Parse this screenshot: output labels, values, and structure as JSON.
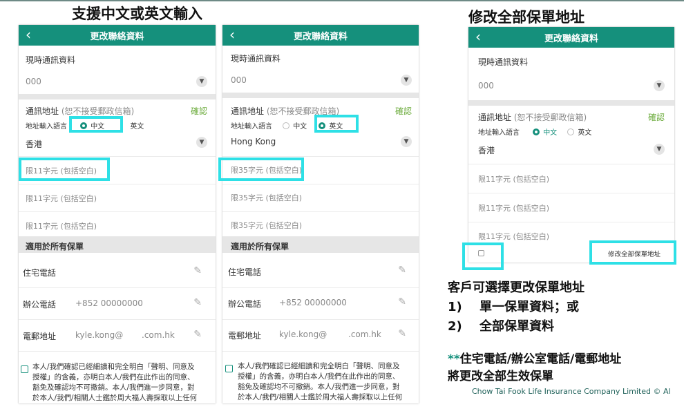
{
  "headings": {
    "left": "支援中文或英文輸入",
    "right": "修改全部保單地址"
  },
  "phones": {
    "header_title": "更改聯絡資料",
    "current_info_label": "現時通訊資料",
    "current_value_left": "000",
    "current_value_mid": "000",
    "current_value_right": "000",
    "address_label": "通訊地址",
    "address_note": "(恕不接受郵政信箱)",
    "confirm": "確認",
    "lang_label": "地址輸入語言",
    "lang_zh": "中文",
    "lang_en": "英文",
    "region_zh": "香港",
    "region_en": "Hong Kong",
    "placeholder_zh": "限11字元 (包括空白)",
    "placeholder_en": "限35字元 (包括空白)",
    "all_policies_band": "適用於所有保單",
    "home_phone": "住宅電話",
    "office_phone": "辦公電話",
    "office_phone_value": "+852 00000000",
    "email_label": "電郵地址",
    "email_user": "kyle.kong@",
    "email_domain": ".com.hk",
    "consent_line1": "本人/我們確認已經細讀和完全明白「聲明、同意及",
    "consent_line2": "授權」的含義，亦明白本人/我們在此作出的同意、",
    "consent_line3": "豁免及確認均不可撤銷。本人/我們進一步同意，對",
    "consent_line4": "於本人/我們/相關人士鑑於周大福人壽採取以上任何",
    "modify_all_button": "修改全部保單地址"
  },
  "notes": {
    "line1": "客戶可選擇更改保單地址",
    "item1_num": "1)",
    "item1_text": "單一保單資料；或",
    "item2_num": "2)",
    "item2_text": "全部保單資料",
    "stars": "**",
    "note_line1": "住宅電話/辦公室電話/電郵地址",
    "note_line2": "將更改全部生效保單",
    "footer": "Chow Tai Fook Life Insurance Company Limited © Al"
  },
  "colors": {
    "header_teal": "#15907c",
    "confirm_green": "#6bab3b",
    "highlight_cyan": "#2ee0e6",
    "star_teal": "#15907c"
  },
  "icons": [
    "back-arrow-icon",
    "chevron-down-icon",
    "radio-icon",
    "pencil-icon",
    "checkbox-icon"
  ]
}
